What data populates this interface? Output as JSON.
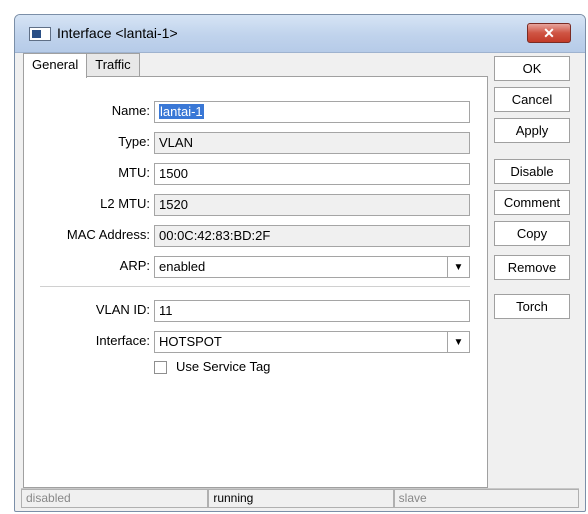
{
  "window": {
    "title": "Interface <lantai-1>",
    "close_glyph": "✕"
  },
  "tabs": [
    {
      "label": "General",
      "active": true
    },
    {
      "label": "Traffic",
      "active": false
    }
  ],
  "form": {
    "name": {
      "label": "Name:",
      "value": "lantai-1"
    },
    "type": {
      "label": "Type:",
      "value": "VLAN"
    },
    "mtu": {
      "label": "MTU:",
      "value": "1500"
    },
    "l2mtu": {
      "label": "L2 MTU:",
      "value": "1520"
    },
    "mac": {
      "label": "MAC Address:",
      "value": "00:0C:42:83:BD:2F"
    },
    "arp": {
      "label": "ARP:",
      "value": "enabled"
    },
    "vlan_id": {
      "label": "VLAN ID:",
      "value": "11"
    },
    "interface": {
      "label": "Interface:",
      "value": "HOTSPOT"
    },
    "use_service_tag": {
      "label": "Use Service Tag",
      "checked": false
    }
  },
  "buttons": {
    "ok": "OK",
    "cancel": "Cancel",
    "apply": "Apply",
    "disable": "Disable",
    "comment": "Comment",
    "copy": "Copy",
    "remove": "Remove",
    "torch": "Torch"
  },
  "status": {
    "state1": "disabled",
    "state2": "running",
    "state3": "slave"
  },
  "icons": {
    "dropdown": "▼"
  },
  "colors": {
    "selection": "#3a78d6",
    "close_button": "#c23a28",
    "titlebar": "#c0d3ec"
  }
}
